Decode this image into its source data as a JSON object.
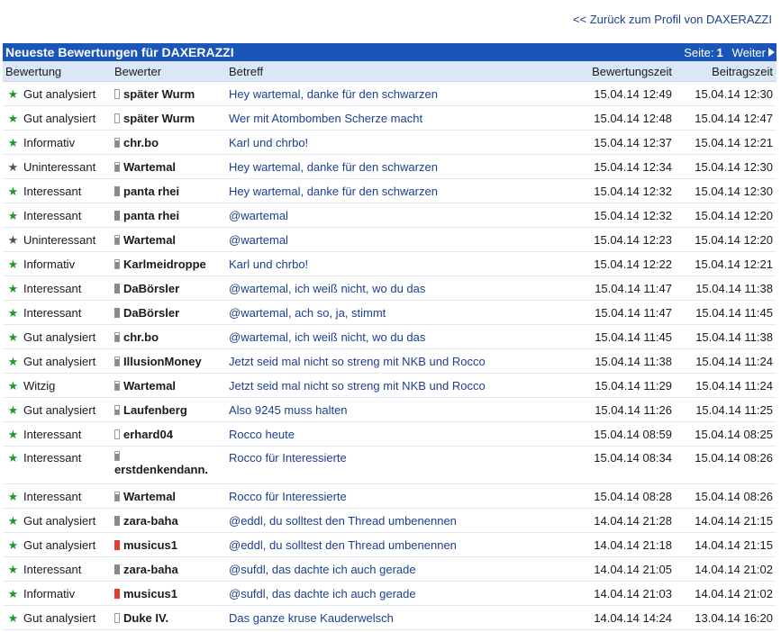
{
  "back_link": "<< Zurück zum Profil von DAXERAZZI",
  "panel": {
    "title": "Neueste Bewertungen für DAXERAZZI",
    "page_label": "Seite:",
    "page_number": "1",
    "next_label": "Weiter"
  },
  "columns": {
    "rating": "Bewertung",
    "rater": "Bewerter",
    "subject": "Betreff",
    "rated_at": "Bewertungszeit",
    "posted_at": "Beitragszeit"
  },
  "colors": {
    "header_bg": "#1a55b8",
    "positive": "#1e9a28",
    "negative": "#505050",
    "link": "#1b3f91"
  },
  "rows": [
    {
      "rating": "Gut analysiert",
      "positive": true,
      "user": "später Wurm",
      "level": "l0",
      "subject": "Hey wartemal, danke für den schwarzen",
      "rated_at": "15.04.14 12:49",
      "posted_at": "15.04.14 12:30"
    },
    {
      "rating": "Gut analysiert",
      "positive": true,
      "user": "später Wurm",
      "level": "l0",
      "subject": "Wer mit Atombomben Scherze macht",
      "rated_at": "15.04.14 12:48",
      "posted_at": "15.04.14 12:47"
    },
    {
      "rating": "Informativ",
      "positive": true,
      "user": "chr.bo",
      "level": "l3",
      "subject": "Karl und chrbo!",
      "rated_at": "15.04.14 12:37",
      "posted_at": "15.04.14 12:21"
    },
    {
      "rating": "Uninteressant",
      "positive": false,
      "user": "Wartemal",
      "level": "l3",
      "subject": "Hey wartemal, danke für den schwarzen",
      "rated_at": "15.04.14 12:34",
      "posted_at": "15.04.14 12:30"
    },
    {
      "rating": "Interessant",
      "positive": true,
      "user": "panta rhei",
      "level": "l4",
      "subject": "Hey wartemal, danke für den schwarzen",
      "rated_at": "15.04.14 12:32",
      "posted_at": "15.04.14 12:30"
    },
    {
      "rating": "Interessant",
      "positive": true,
      "user": "panta rhei",
      "level": "l4",
      "subject": "@wartemal",
      "rated_at": "15.04.14 12:32",
      "posted_at": "15.04.14 12:20"
    },
    {
      "rating": "Uninteressant",
      "positive": false,
      "user": "Wartemal",
      "level": "l3",
      "subject": "@wartemal",
      "rated_at": "15.04.14 12:23",
      "posted_at": "15.04.14 12:20"
    },
    {
      "rating": "Informativ",
      "positive": true,
      "user": "Karlmeidroppe",
      "level": "l3",
      "subject": "Karl und chrbo!",
      "rated_at": "15.04.14 12:22",
      "posted_at": "15.04.14 12:21"
    },
    {
      "rating": "Interessant",
      "positive": true,
      "user": "DaBörsler",
      "level": "l4",
      "subject": "@wartemal, ich weiß nicht, wo du das",
      "rated_at": "15.04.14 11:47",
      "posted_at": "15.04.14 11:38"
    },
    {
      "rating": "Interessant",
      "positive": true,
      "user": "DaBörsler",
      "level": "l4",
      "subject": "@wartemal, ach so, ja, stimmt",
      "rated_at": "15.04.14 11:47",
      "posted_at": "15.04.14 11:45"
    },
    {
      "rating": "Gut analysiert",
      "positive": true,
      "user": "chr.bo",
      "level": "l3",
      "subject": "@wartemal, ich weiß nicht, wo du das",
      "rated_at": "15.04.14 11:45",
      "posted_at": "15.04.14 11:38"
    },
    {
      "rating": "Gut analysiert",
      "positive": true,
      "user": "IllusionMoney",
      "level": "l3",
      "subject": "Jetzt seid mal nicht so streng mit NKB und Rocco",
      "rated_at": "15.04.14 11:38",
      "posted_at": "15.04.14 11:24"
    },
    {
      "rating": "Witzig",
      "positive": true,
      "user": "Wartemal",
      "level": "l3",
      "subject": "Jetzt seid mal nicht so streng mit NKB und Rocco",
      "rated_at": "15.04.14 11:29",
      "posted_at": "15.04.14 11:24"
    },
    {
      "rating": "Gut analysiert",
      "positive": true,
      "user": "Laufenberg",
      "level": "l2",
      "subject": "Also 9245 muss halten",
      "rated_at": "15.04.14 11:26",
      "posted_at": "15.04.14 11:25"
    },
    {
      "rating": "Interessant",
      "positive": true,
      "user": "erhard04",
      "level": "l0",
      "subject": "Rocco heute",
      "rated_at": "15.04.14 08:59",
      "posted_at": "15.04.14 08:25"
    },
    {
      "rating": "Interessant",
      "positive": true,
      "user": "erstdenkendann.",
      "level": "l3",
      "subject": "Rocco für Interessierte",
      "rated_at": "15.04.14 08:34",
      "posted_at": "15.04.14 08:26",
      "tall": true
    },
    {
      "rating": "Interessant",
      "positive": true,
      "user": "Wartemal",
      "level": "l3",
      "subject": "Rocco für Interessierte",
      "rated_at": "15.04.14 08:28",
      "posted_at": "15.04.14 08:26"
    },
    {
      "rating": "Gut analysiert",
      "positive": true,
      "user": "zara-baha",
      "level": "l4",
      "subject": "@eddl, du solltest den Thread umbenennen",
      "rated_at": "14.04.14 21:28",
      "posted_at": "14.04.14 21:15"
    },
    {
      "rating": "Gut analysiert",
      "positive": true,
      "user": "musicus1",
      "level": "red",
      "subject": "@eddl, du solltest den Thread umbenennen",
      "rated_at": "14.04.14 21:18",
      "posted_at": "14.04.14 21:15"
    },
    {
      "rating": "Interessant",
      "positive": true,
      "user": "zara-baha",
      "level": "l4",
      "subject": "@sufdl, das dachte ich auch gerade",
      "rated_at": "14.04.14 21:05",
      "posted_at": "14.04.14 21:02"
    },
    {
      "rating": "Informativ",
      "positive": true,
      "user": "musicus1",
      "level": "red",
      "subject": "@sufdl, das dachte ich auch gerade",
      "rated_at": "14.04.14 21:03",
      "posted_at": "14.04.14 21:02"
    },
    {
      "rating": "Gut analysiert",
      "positive": true,
      "user": "Duke IV.",
      "level": "l0",
      "subject": "Das ganze kruse Kauderwelsch",
      "rated_at": "14.04.14 14:24",
      "posted_at": "13.04.14 16:20"
    }
  ]
}
